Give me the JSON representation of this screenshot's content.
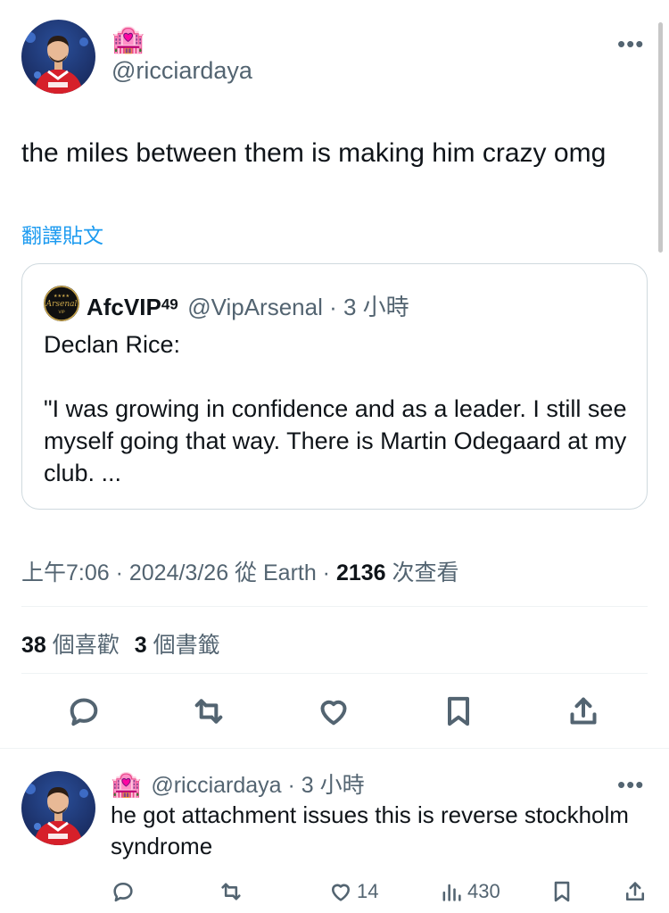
{
  "tweet": {
    "author_emoji": "🏩",
    "handle": "@ricciardaya",
    "more": "•••",
    "text": "the miles between them is making him crazy omg",
    "translate_label": "翻譯貼文",
    "quote": {
      "name": "AfcVIP",
      "name_sup": "49",
      "handle_time": "@VipArsenal · 3 小時",
      "text": "Declan Rice:\n\n\"I was growing in confidence and as a leader. I still see myself going that way. There is Martin Odegaard at my club. ..."
    },
    "meta": {
      "time_date_source": "上午7:06 · 2024/3/26 從 Earth · ",
      "views_count": "2136",
      "views_label": " 次查看"
    },
    "counts": {
      "likes": "38",
      "likes_label": " 個喜歡",
      "bookmarks": "3",
      "bookmarks_label": " 個書籤"
    }
  },
  "reply": {
    "author_emoji": "🏩",
    "handle_time": "@ricciardaya · 3 小時",
    "more": "•••",
    "text": "he got attachment issues this is reverse stockholm syndrome",
    "likes": "14",
    "views": "430"
  },
  "icons": [
    "reply-icon",
    "retweet-icon",
    "like-icon",
    "bookmark-icon",
    "share-icon",
    "views-icon"
  ],
  "colors": {
    "link": "#1d9bf0",
    "secondary_text": "#536471",
    "divider": "#eff3f4",
    "jersey_red": "#d6202a"
  }
}
